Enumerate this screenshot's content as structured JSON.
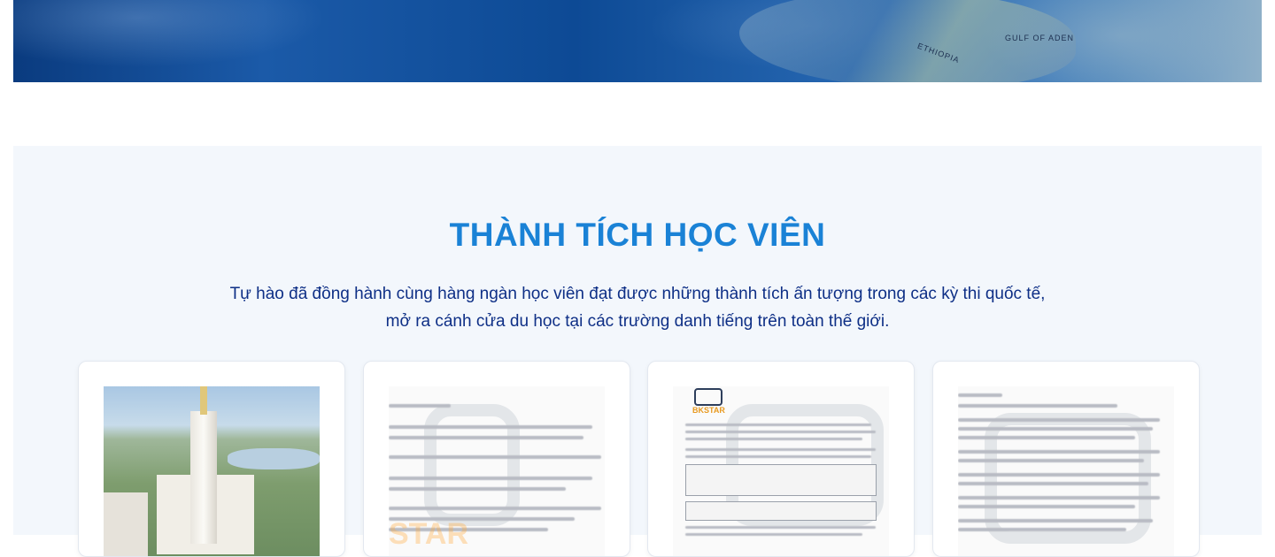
{
  "hero": {
    "map_labels": [
      "GULF OF ADEN",
      "ETHIOPIA"
    ]
  },
  "achievements": {
    "title": "THÀNH TÍCH HỌC VIÊN",
    "subtitle_line1": "Tự hào đã đồng hành cùng hàng ngàn học viên đạt được những thành tích ấn tượng trong các kỳ thi quốc tế,",
    "subtitle_line2": "mở ra cánh cửa du học tại các trường danh tiếng trên toàn thế giới.",
    "cards": [
      {
        "kind": "campus-photo"
      },
      {
        "kind": "scholarship-letter",
        "watermark": "STAR"
      },
      {
        "kind": "admission-letter",
        "logo_text": "BKSTAR"
      },
      {
        "kind": "admission-letter-ntu"
      }
    ]
  }
}
